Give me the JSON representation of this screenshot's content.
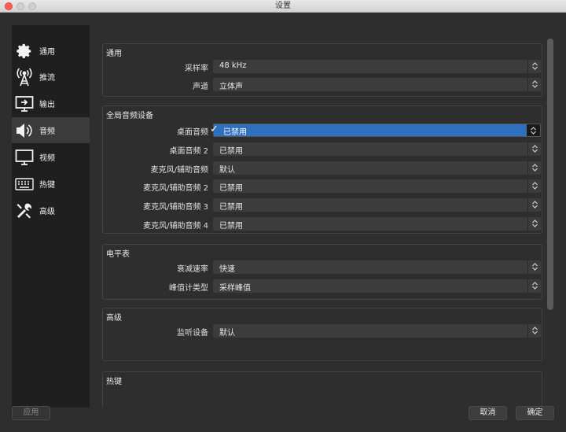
{
  "window": {
    "title": "设置"
  },
  "sidebar": {
    "items": [
      {
        "label": "通用",
        "icon": "gear-icon"
      },
      {
        "label": "推流",
        "icon": "broadcast-tower-icon"
      },
      {
        "label": "输出",
        "icon": "output-monitor-icon"
      },
      {
        "label": "音频",
        "icon": "speaker-icon",
        "active": true
      },
      {
        "label": "视频",
        "icon": "monitor-icon"
      },
      {
        "label": "热键",
        "icon": "keyboard-icon"
      },
      {
        "label": "高级",
        "icon": "tools-icon"
      }
    ]
  },
  "groups": {
    "general": {
      "title": "通用",
      "rows": [
        {
          "label": "采样率",
          "value": "48 kHz"
        },
        {
          "label": "声道",
          "value": "立体声"
        }
      ]
    },
    "global_audio": {
      "title": "全局音频设备",
      "rows": [
        {
          "label": "桌面音频",
          "value": "已禁用",
          "open": true
        },
        {
          "label": "桌面音频 2",
          "value": "已禁用"
        },
        {
          "label": "麦克风/辅助音频",
          "value": "默认"
        },
        {
          "label": "麦克风/辅助音频 2",
          "value": "已禁用"
        },
        {
          "label": "麦克风/辅助音频 3",
          "value": "已禁用"
        },
        {
          "label": "麦克风/辅助音频 4",
          "value": "已禁用"
        }
      ]
    },
    "meters": {
      "title": "电平表",
      "rows": [
        {
          "label": "衰减速率",
          "value": "快速"
        },
        {
          "label": "峰值计类型",
          "value": "采样峰值"
        }
      ]
    },
    "advanced": {
      "title": "高级",
      "rows": [
        {
          "label": "监听设备",
          "value": "默认"
        }
      ]
    },
    "hotkeys": {
      "title": "热键"
    }
  },
  "footer": {
    "apply": "应用",
    "cancel": "取消",
    "ok": "确定"
  },
  "colors": {
    "accent": "#2f6fbf",
    "background": "#2e2e2e",
    "sidebar": "#1f1f1f"
  }
}
